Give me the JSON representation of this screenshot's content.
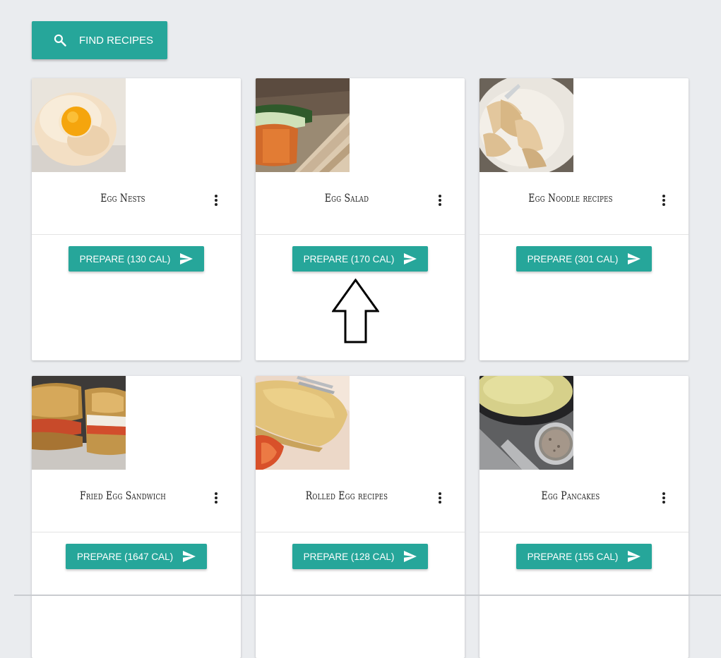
{
  "toolbar": {
    "find_label": "FIND RECIPES",
    "find_icon": "search-icon"
  },
  "colors": {
    "accent": "#26a69a",
    "background": "#eaecef",
    "card": "#ffffff"
  },
  "recipes": [
    {
      "title": "Egg Nests",
      "prepare_label": "PREPARE (130 CAL)",
      "image": "egg-nest-photo"
    },
    {
      "title": "Egg Salad",
      "prepare_label": "PREPARE (170 CAL)",
      "image": "egg-salad-sandwich-photo"
    },
    {
      "title": "Egg Noodle recipes",
      "prepare_label": "PREPARE (301 CAL)",
      "image": "egg-noodles-photo"
    },
    {
      "title": "Fried Egg Sandwich",
      "prepare_label": "PREPARE (1647 CAL)",
      "image": "fried-egg-sandwich-photo"
    },
    {
      "title": "Rolled Egg recipes",
      "prepare_label": "PREPARE (128 CAL)",
      "image": "rolled-egg-photo"
    },
    {
      "title": "Egg Pancakes",
      "prepare_label": "PREPARE (155 CAL)",
      "image": "egg-pancake-photo"
    }
  ]
}
